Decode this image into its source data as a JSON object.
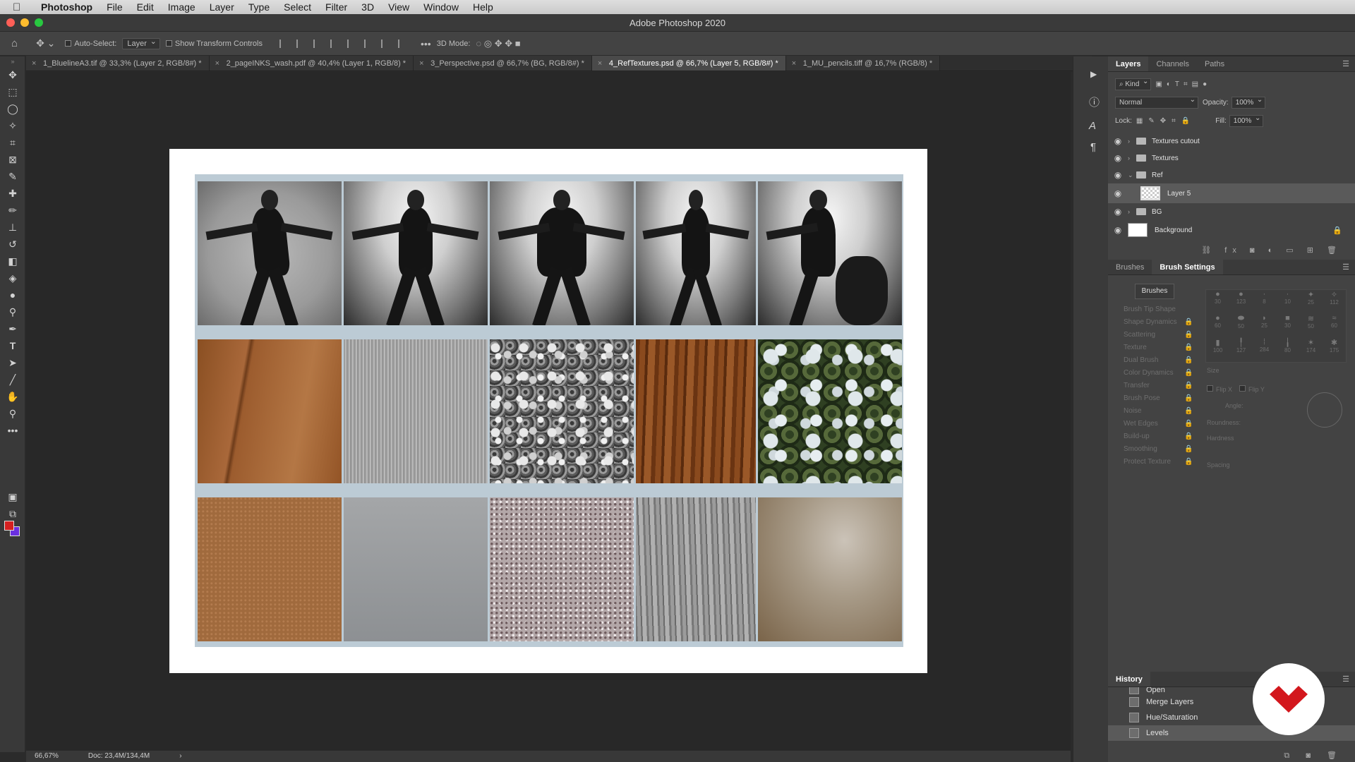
{
  "menubar": {
    "app": "Photoshop",
    "items": [
      "File",
      "Edit",
      "Image",
      "Layer",
      "Type",
      "Select",
      "Filter",
      "3D",
      "View",
      "Window",
      "Help"
    ]
  },
  "window": {
    "title": "Adobe Photoshop 2020"
  },
  "options": {
    "auto_select_label": "Auto-Select:",
    "auto_select_value": "Layer",
    "show_transform": "Show Transform Controls",
    "mode_3d": "3D Mode:"
  },
  "tabs": [
    {
      "label": "1_BluelineA3.tif @ 33,3% (Layer 2, RGB/8#) *"
    },
    {
      "label": "2_pageINKS_wash.pdf @ 40,4% (Layer 1, RGB/8) *"
    },
    {
      "label": "3_Perspective.psd @ 66,7% (BG, RGB/8#) *"
    },
    {
      "label": "4_RefTextures.psd @ 66,7% (Layer 5, RGB/8#) *"
    },
    {
      "label": "1_MU_pencils.tiff @ 16,7% (RGB/8) *"
    }
  ],
  "active_tab_index": 3,
  "status": {
    "zoom": "66,67%",
    "doc": "Doc: 23,4M/134,4M",
    "arrow": "›"
  },
  "layers_panel": {
    "tabs": [
      "Layers",
      "Channels",
      "Paths"
    ],
    "filter": "Kind",
    "blend": "Normal",
    "opacity_label": "Opacity:",
    "opacity": "100%",
    "lock_label": "Lock:",
    "fill_label": "Fill:",
    "fill": "100%",
    "layers": [
      {
        "name": "Textures cutout",
        "type": "group",
        "expanded": false
      },
      {
        "name": "Textures",
        "type": "group",
        "expanded": false
      },
      {
        "name": "Ref",
        "type": "group",
        "expanded": true
      },
      {
        "name": "Layer 5",
        "type": "layer",
        "selected": true
      },
      {
        "name": "BG",
        "type": "group",
        "expanded": false
      },
      {
        "name": "Background",
        "type": "background",
        "locked": true
      }
    ]
  },
  "brush_panel": {
    "tabs": [
      "Brushes",
      "Brush Settings"
    ],
    "brushes_button": "Brushes",
    "options": [
      "Brush Tip Shape",
      "Shape Dynamics",
      "Scattering",
      "Texture",
      "Dual Brush",
      "Color Dynamics",
      "Transfer",
      "Brush Pose",
      "Noise",
      "Wet Edges",
      "Build-up",
      "Smoothing",
      "Protect Texture"
    ],
    "preset_sizes": [
      "30",
      "123",
      "8",
      "10",
      "25",
      "112",
      "60",
      "50",
      "25",
      "30",
      "50",
      "60",
      "100",
      "127",
      "284",
      "80",
      "174",
      "175"
    ],
    "size_label": "Size",
    "flip_x": "Flip X",
    "flip_y": "Flip Y",
    "angle_label": "Angle:",
    "roundness_label": "Roundness:",
    "hardness_label": "Hardness",
    "spacing_label": "Spacing"
  },
  "history_panel": {
    "title": "History",
    "items": [
      "Open",
      "Merge Layers",
      "Hue/Saturation",
      "Levels"
    ],
    "active_index": 3
  },
  "colors": {
    "foreground": "#d42020",
    "background": "#6a2fe0",
    "accent": "#d3171d"
  }
}
